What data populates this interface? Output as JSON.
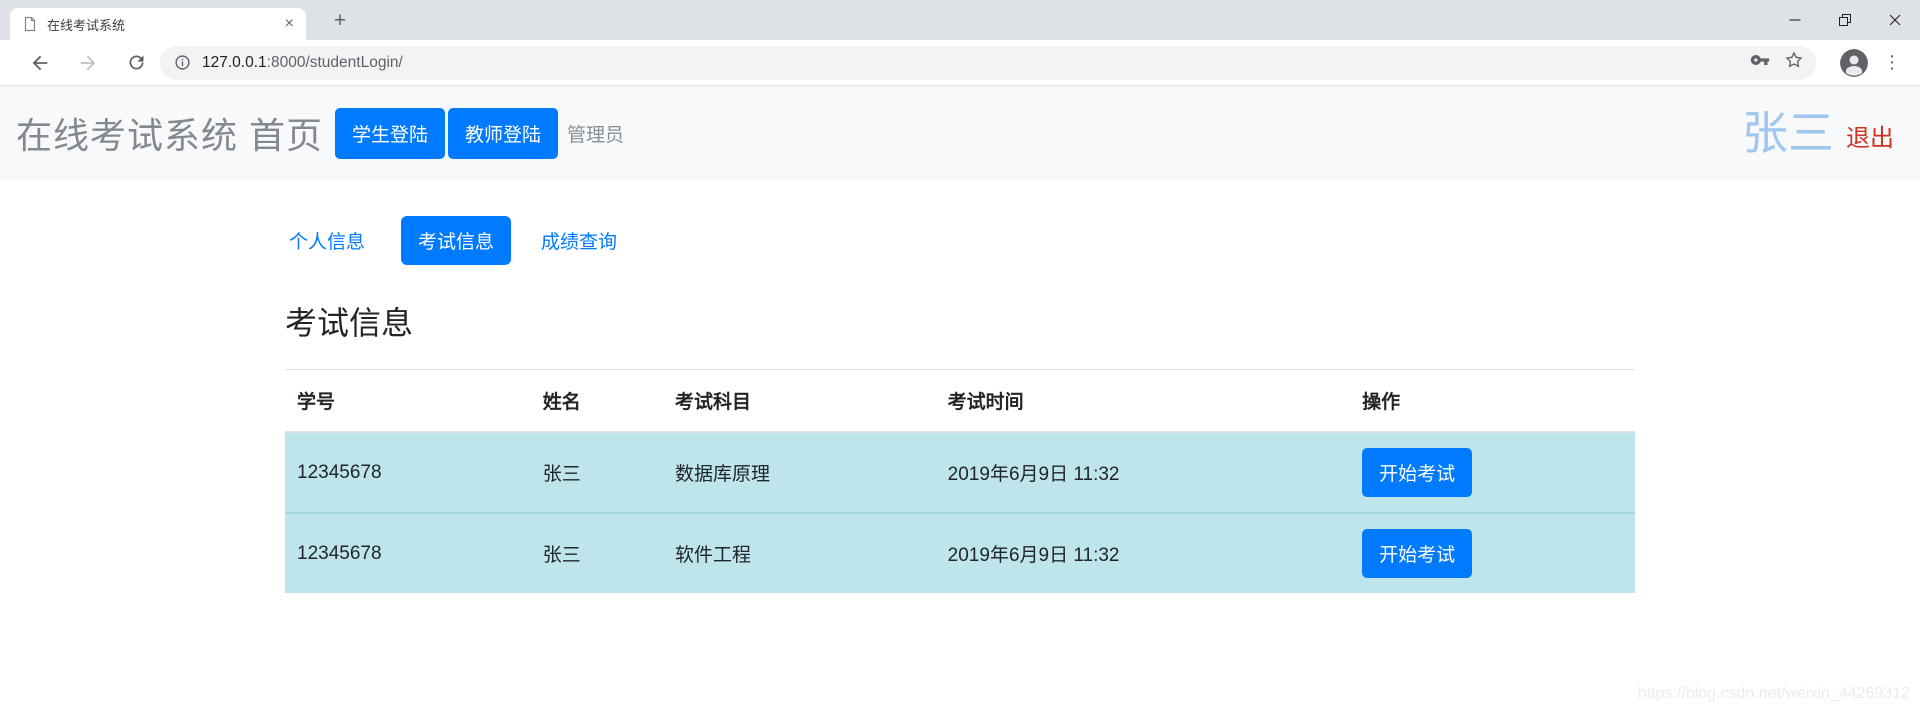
{
  "browser": {
    "tab_title": "在线考试系统",
    "url_host": "127.0.0.1",
    "url_path": ":8000/studentLogin/"
  },
  "icons": {
    "tab_close": "×",
    "new_tab": "+",
    "menu_dots": "⋮"
  },
  "header": {
    "brand": "在线考试系统 首页",
    "student_login": "学生登陆",
    "teacher_login": "教师登陆",
    "admin": "管理员",
    "username": "张三",
    "logout": "退出"
  },
  "tabs": [
    {
      "label": "个人信息",
      "active": false
    },
    {
      "label": "考试信息",
      "active": true
    },
    {
      "label": "成绩查询",
      "active": false
    }
  ],
  "section_title": "考试信息",
  "exam_table": {
    "headers": [
      "学号",
      "姓名",
      "考试科目",
      "考试时间",
      "操作"
    ],
    "rows": [
      {
        "student_id": "12345678",
        "name": "张三",
        "subject": "数据库原理",
        "time": "2019年6月9日 11:32",
        "action": "开始考试"
      },
      {
        "student_id": "12345678",
        "name": "张三",
        "subject": "软件工程",
        "time": "2019年6月9日 11:32",
        "action": "开始考试"
      }
    ]
  },
  "watermark": "https://blog.csdn.net/weixin_44269312",
  "colors": {
    "primary": "#007bff",
    "row_bg": "#bee5eb",
    "row_border": "#a5d9e1",
    "header_bg": "#f8f9fa",
    "username": "#9fc7ef",
    "logout": "#d32f1e",
    "chrome_strip": "#dee1e6"
  }
}
